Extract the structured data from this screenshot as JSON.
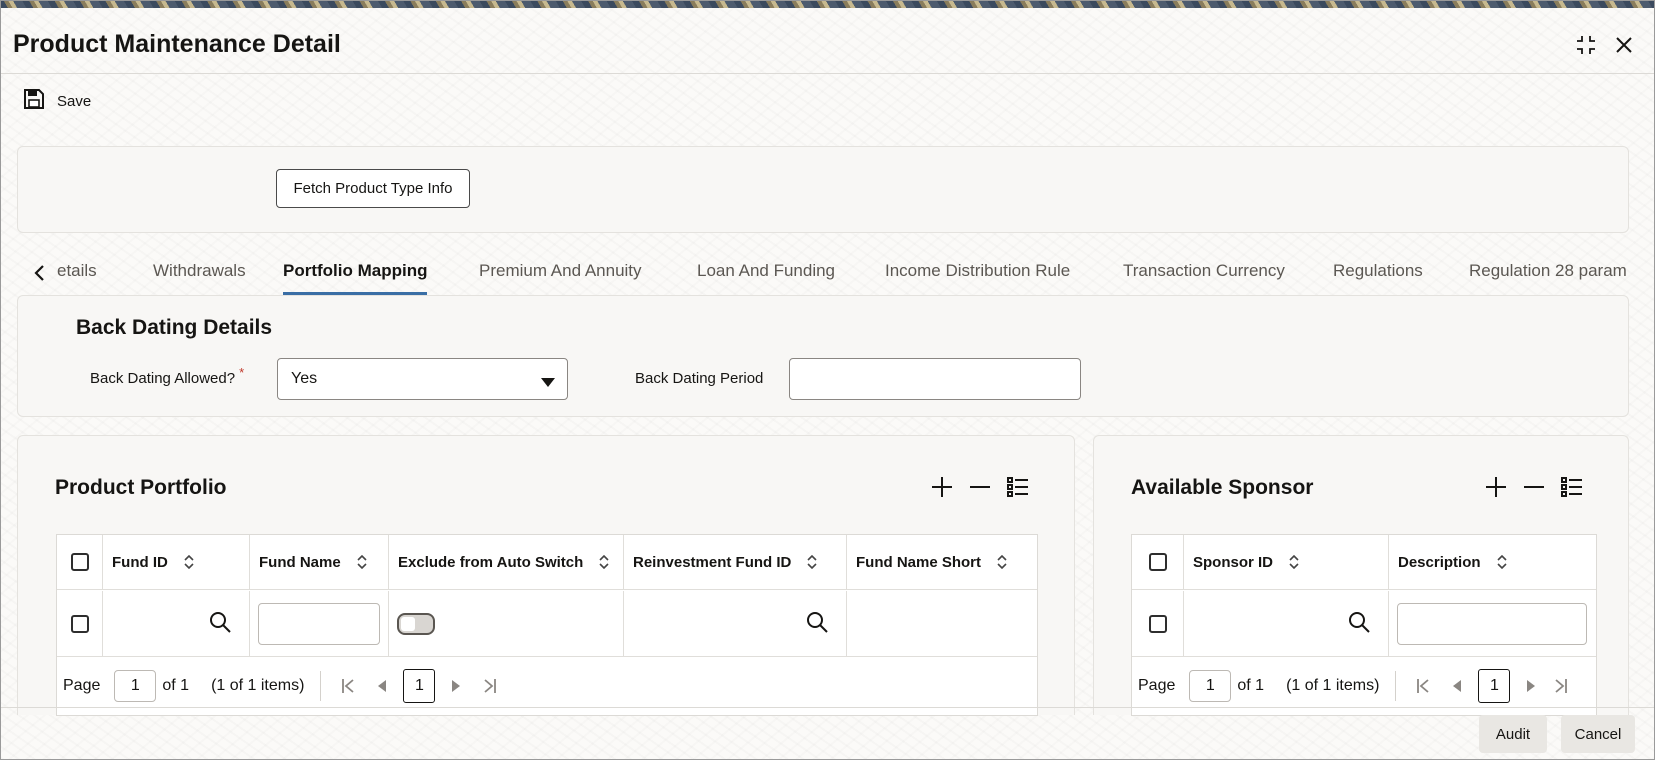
{
  "window": {
    "title": "Product Maintenance Detail",
    "maximize_icon": "collapse-icon",
    "close_icon": "close-icon"
  },
  "toolbar": {
    "save_label": "Save"
  },
  "header_panel": {
    "fetch_button": "Fetch Product Type Info"
  },
  "tabs": [
    {
      "label": "Details",
      "shown": "etails"
    },
    {
      "label": "Withdrawals"
    },
    {
      "label": "Portfolio Mapping",
      "active": true
    },
    {
      "label": "Premium And Annuity"
    },
    {
      "label": "Loan And Funding"
    },
    {
      "label": "Income Distribution Rule"
    },
    {
      "label": "Transaction Currency"
    },
    {
      "label": "Regulations"
    },
    {
      "label": "Regulation 28 param"
    }
  ],
  "back_dating": {
    "title": "Back Dating Details",
    "allowed_label": "Back Dating Allowed?",
    "required_mark": "*",
    "allowed_value": "Yes",
    "period_label": "Back Dating Period",
    "period_value": ""
  },
  "product_portfolio": {
    "title": "Product Portfolio",
    "columns": [
      "Fund ID",
      "Fund Name",
      "Exclude from Auto Switch",
      "Reinvestment Fund ID",
      "Fund Name Short"
    ],
    "pager": {
      "page_label": "Page",
      "page_value": "1",
      "of_label": "of 1",
      "items_label": "(1 of 1 items)",
      "current": "1"
    }
  },
  "available_sponsor": {
    "title": "Available Sponsor",
    "columns": [
      "Sponsor ID",
      "Description"
    ],
    "pager": {
      "page_label": "Page",
      "page_value": "1",
      "of_label": "of 1",
      "items_label": "(1 of 1 items)",
      "current": "1"
    }
  },
  "footer": {
    "audit_label": "Audit",
    "cancel_label": "Cancel"
  }
}
